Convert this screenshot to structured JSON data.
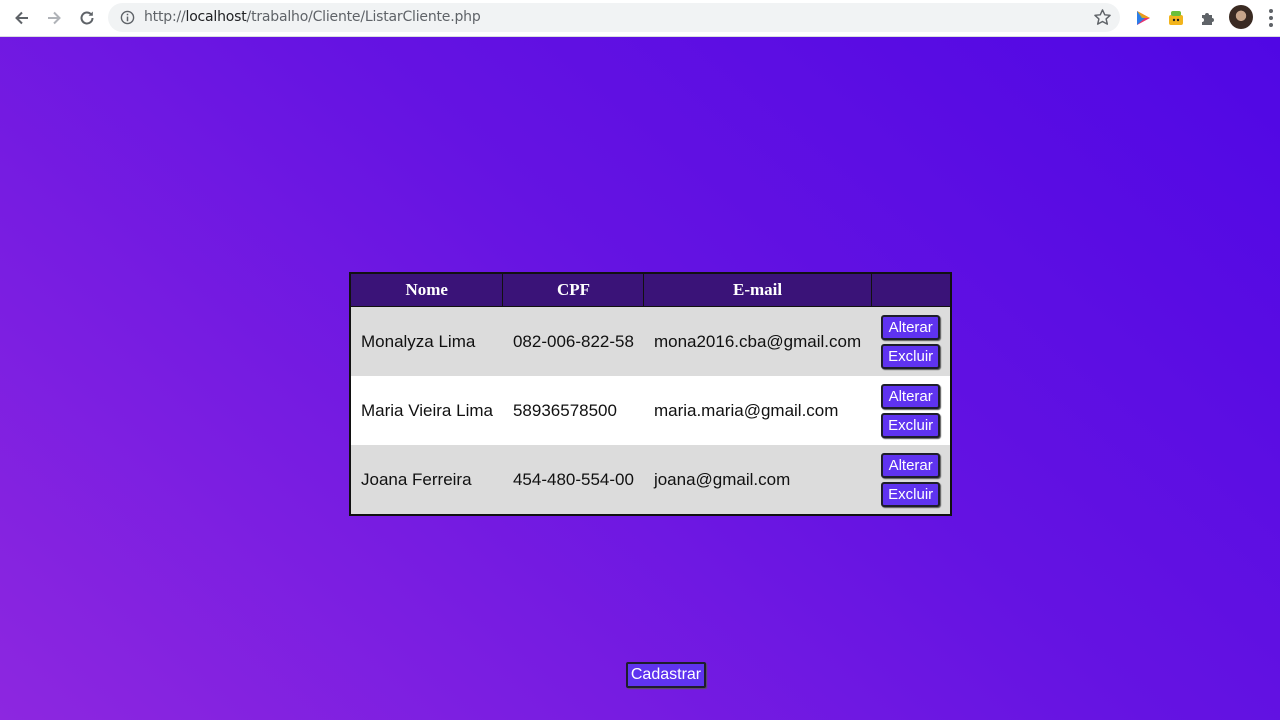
{
  "browser": {
    "url_prefix": "http://",
    "url_host": "localhost",
    "url_path": "/trabalho/Cliente/ListarCliente.php",
    "icons": [
      "back-icon",
      "forward-icon",
      "reload-icon",
      "info-icon",
      "star-icon",
      "play-extension-icon",
      "food-extension-icon",
      "puzzle-extensions-icon",
      "profile-avatar",
      "menu-icon"
    ]
  },
  "table": {
    "headers": [
      "Nome",
      "CPF",
      "E-mail",
      ""
    ],
    "rows": [
      {
        "nome": "Monalyza Lima",
        "cpf": "082-006-822-58",
        "email": "mona2016.cba@gmail.com",
        "alterar": "Alterar",
        "excluir": "Excluir"
      },
      {
        "nome": "Maria Vieira Lima",
        "cpf": "58936578500",
        "email": "maria.maria@gmail.com",
        "alterar": "Alterar",
        "excluir": "Excluir"
      },
      {
        "nome": "Joana Ferreira",
        "cpf": "454-480-554-00",
        "email": "joana@gmail.com",
        "alterar": "Alterar",
        "excluir": "Excluir"
      }
    ]
  },
  "cadastrar_label": "Cadastrar",
  "colors": {
    "background_start": "#8d27e0",
    "background_end": "#5007e4",
    "header_bg": "#3a1378",
    "button_bg": "#5f33f0",
    "row_odd": "#dcdcdc",
    "row_even": "#ffffff"
  }
}
